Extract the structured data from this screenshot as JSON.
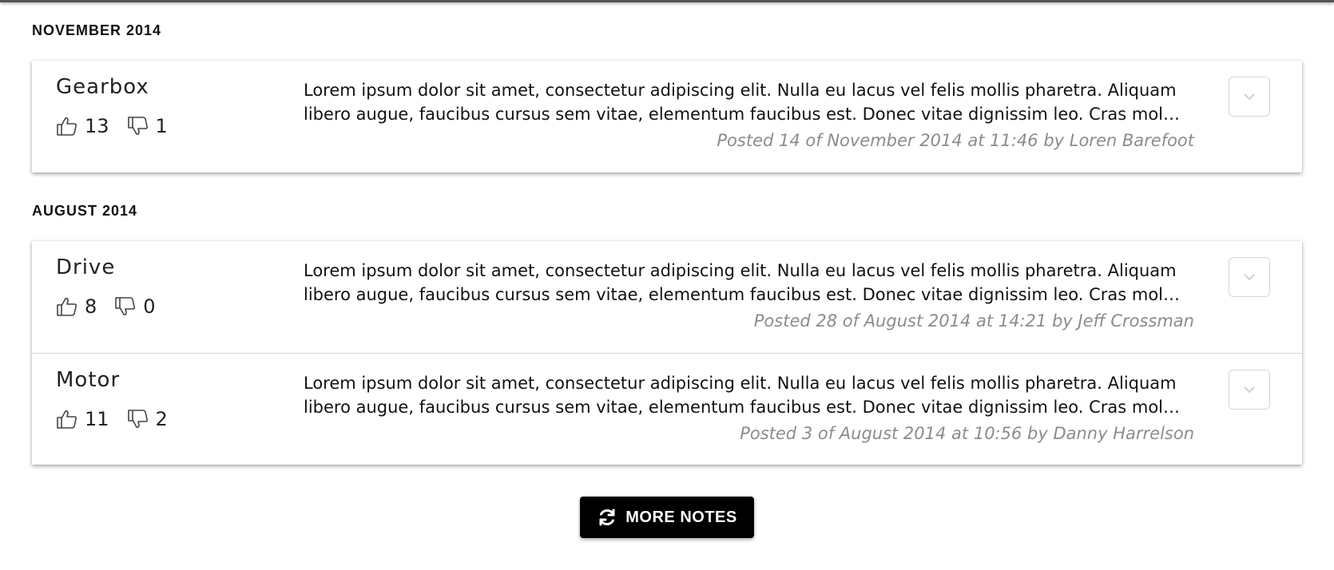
{
  "sections": [
    {
      "heading": "NOVEMBER 2014",
      "notes": [
        {
          "title": "Gearbox",
          "likes": "13",
          "dislikes": "1",
          "body": "Lorem ipsum dolor sit amet, consectetur adipiscing elit. Nulla eu lacus vel felis mollis pharetra. Aliquam libero augue, faucibus cursus sem vitae, elementum faucibus est. Donec vitae dignissim leo. Cras mol…",
          "meta": "Posted 14 of November 2014 at 11:46 by Loren Barefoot"
        }
      ]
    },
    {
      "heading": "AUGUST 2014",
      "notes": [
        {
          "title": "Drive",
          "likes": "8",
          "dislikes": "0",
          "body": "Lorem ipsum dolor sit amet, consectetur adipiscing elit. Nulla eu lacus vel felis mollis pharetra. Aliquam libero augue, faucibus cursus sem vitae, elementum faucibus est. Donec vitae dignissim leo. Cras mol…",
          "meta": "Posted 28 of August 2014 at 14:21 by Jeff Crossman"
        },
        {
          "title": "Motor",
          "likes": "11",
          "dislikes": "2",
          "body": "Lorem ipsum dolor sit amet, consectetur adipiscing elit. Nulla eu lacus vel felis mollis pharetra. Aliquam libero augue, faucibus cursus sem vitae, elementum faucibus est. Donec vitae dignissim leo. Cras mol…",
          "meta": "Posted 3 of August 2014 at 10:56 by Danny Harrelson"
        }
      ]
    }
  ],
  "more_button": {
    "label": "MORE NOTES",
    "icon": "refresh-icon"
  },
  "icons": {
    "like": "thumbs-up-icon",
    "dislike": "thumbs-down-icon",
    "expand": "chevron-down-icon"
  },
  "colors": {
    "meta_text": "#8c8c8c",
    "button_bg": "#000000",
    "button_text": "#ffffff"
  }
}
